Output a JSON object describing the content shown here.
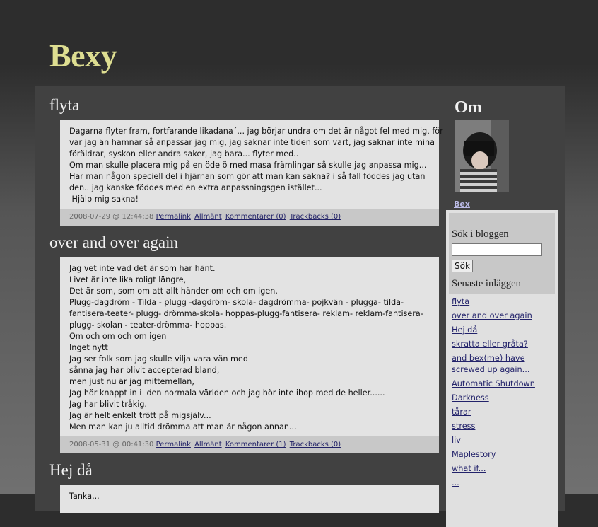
{
  "site": {
    "title": "Bexy"
  },
  "posts": [
    {
      "title": "flyta",
      "lines": [
        "Dagarna flyter fram, fortfarande likadana´... jag börjar undra om det är något fel med mig, för",
        "var jag än hamnar så anpassar jag mig, jag saknar inte tiden som vart, jag saknar inte mina",
        "föräldrar, syskon eller andra saker, jag bara... flyter med..",
        "Om man skulle placera mig på en öde ö med masa främlingar så skulle jag anpassa mig...",
        "Har man någon speciell del i hjärnan som gör att man kan sakna? i så fall föddes jag utan",
        "den.. jag kanske föddes med en extra anpassningsgen istället...",
        " Hjälp mig sakna!"
      ],
      "date": "2008-07-29 @ 12:44:38",
      "permalink": "Permalink",
      "category": "Allmänt",
      "comments": "Kommentarer (0)",
      "trackbacks": "Trackbacks (0)"
    },
    {
      "title": "over and over again",
      "lines": [
        "Jag vet inte vad det är som har hänt.",
        "Livet är inte lika roligt längre,",
        "Det är som, som om att allt händer om och om igen.",
        "Plugg-dagdröm - Tilda - plugg -dagdröm- skola- dagdrömma- pojkvän - plugga- tilda-",
        "fantisera-teater- plugg- drömma-skola- hoppas-plugg-fantisera- reklam- reklam-fantisera-",
        "plugg- skolan - teater-drömma- hoppas.",
        "Om och om och om igen",
        "Inget nytt",
        "Jag ser folk som jag skulle vilja vara vän med",
        "sånna jag har blivit accepterad bland,",
        "men just nu är jag mittemellan,",
        "Jag hör knappt in i  den normala världen och jag hör inte ihop med de heller......",
        "Jag har blivit tråkig.",
        "Jag är helt enkelt trött på migsjälv...",
        "Men man kan ju alltid drömma att man är någon annan..."
      ],
      "date": "2008-05-31 @ 00:41:30",
      "permalink": "Permalink",
      "category": "Allmänt",
      "comments": "Kommentarer (1)",
      "trackbacks": "Trackbacks (0)"
    },
    {
      "title": "Hej då",
      "lines": [
        "Tanka..."
      ]
    }
  ],
  "sidebar": {
    "about_heading": "Om",
    "author_link": "Bex",
    "search_label": "Sök i bloggen",
    "search_value": "",
    "search_button": "Sök",
    "recent_label": "Senaste inläggen",
    "recent_links": [
      "flyta",
      "over and over again",
      "Hej då",
      "skratta eller gråta?",
      "and bex(me) have screwed up again...",
      "Automatic Shutdown",
      "Darkness",
      "tårar",
      "stress",
      "liv",
      "Maplestory",
      "what if...",
      "..."
    ]
  }
}
